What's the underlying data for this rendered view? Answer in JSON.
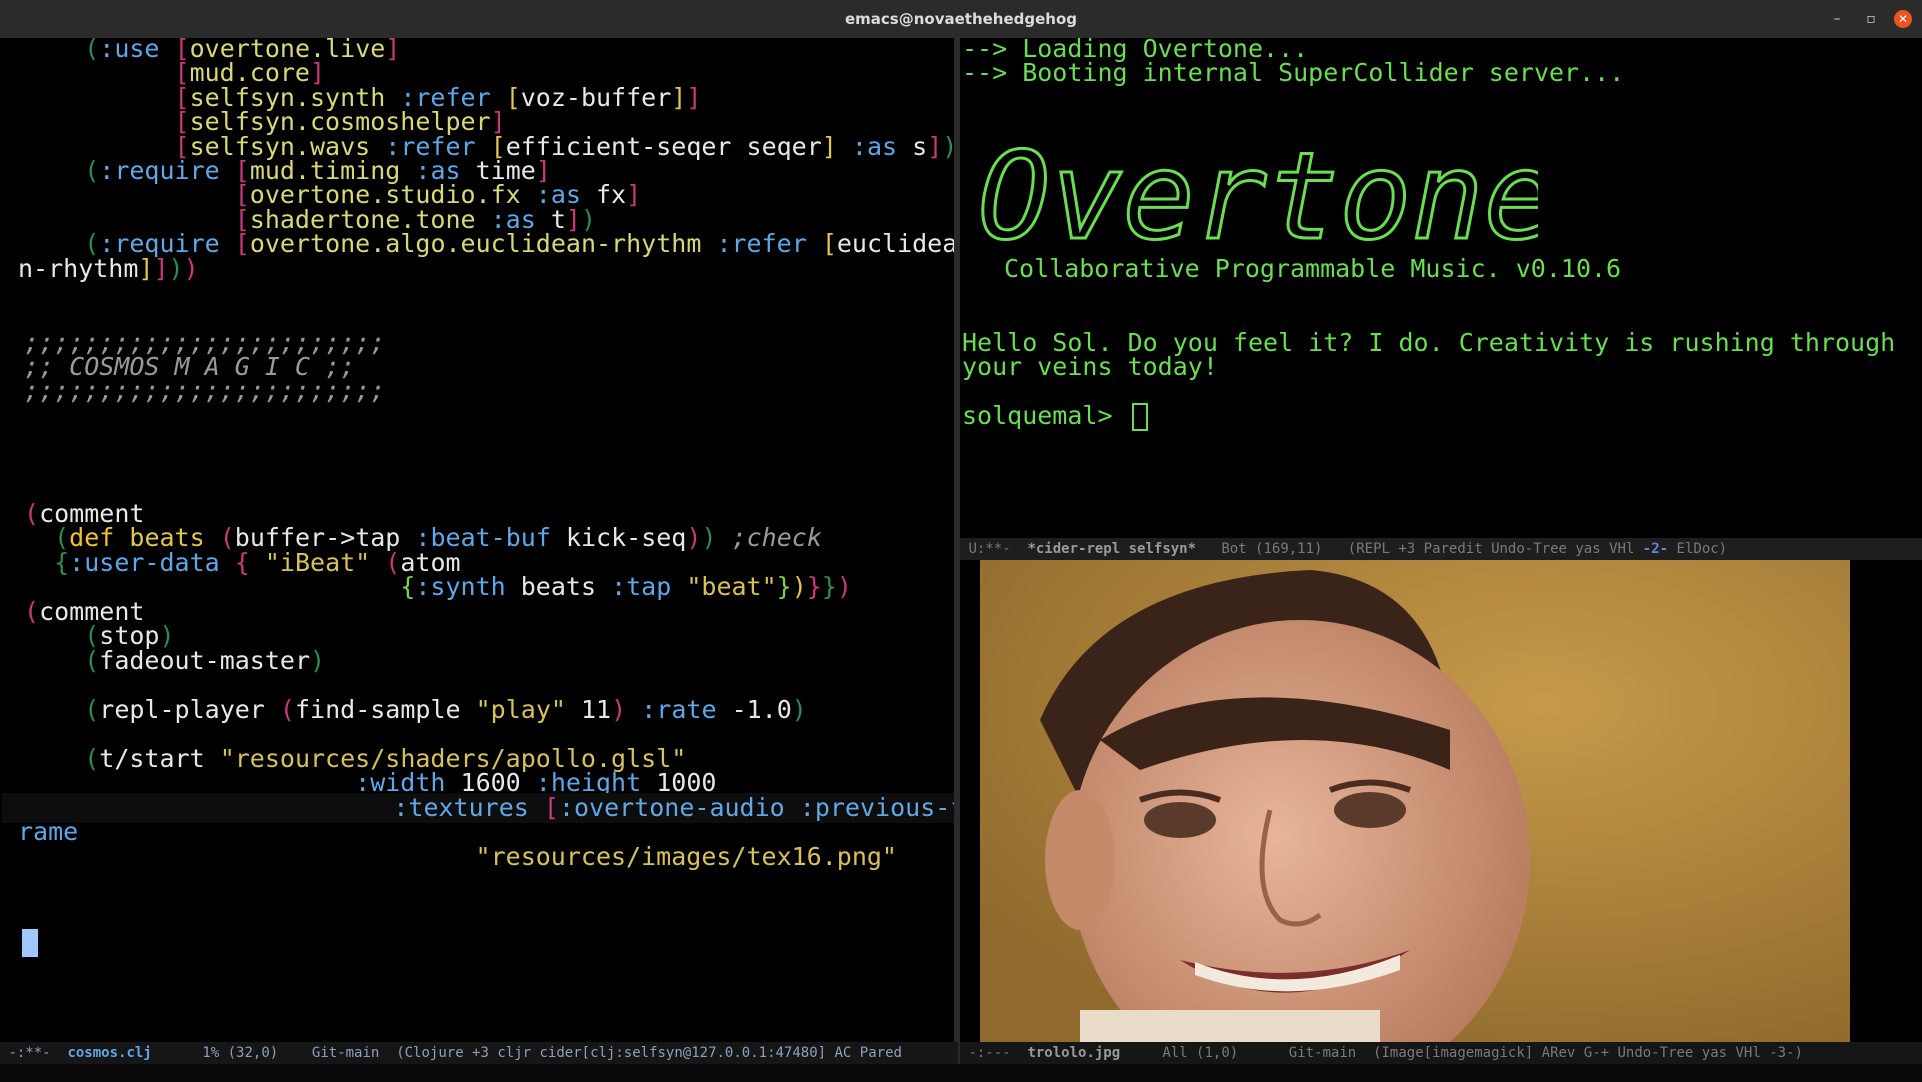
{
  "window": {
    "title": "emacs@novaethehedgehog"
  },
  "editor": {
    "lines": [
      "(:use [overtone.live]",
      "      [mud.core]",
      "      [selfsyn.synth :refer [voz-buffer]]",
      "      [selfsyn.cosmoshelper]",
      "      [selfsyn.wavs :refer [efficient-seqer seqer] :as s])",
      "(:require [mud.timing :as time]",
      "          [overtone.studio.fx :as fx]",
      "          [shadertone.tone :as t])",
      "(:require [overtone.algo.euclidean-rhythm :refer [euclidea",
      "n-rhythm]]))",
      ";;;;;;;;;;;;;;;;;;;;;;;;",
      ";; COSMOS M A G I C ;;",
      ";;;;;;;;;;;;;;;;;;;;;;;;",
      "(comment",
      "(def beats (buffer->tap :beat-buf kick-seq)) ;check",
      "{:user-data { \"iBeat\" (atom",
      "{:synth beats :tap \"beat\"})}})",
      "(comment",
      "(stop)",
      "(fadeout-master)",
      "(repl-player (find-sample \"play\" 11) :rate -1.0)",
      "(t/start \"resources/shaders/apollo.glsl\"",
      ":width 1600 :height 1000",
      ":textures [:overtone-audio :previous-f",
      "rame",
      "\"resources/images/tex16.png\""
    ]
  },
  "repl": {
    "loading": "--> Loading Overtone...",
    "booting": "--> Booting internal SuperCollider server...",
    "logo": "Overtone",
    "tagline": "Collaborative Programmable Music. v0.10.6",
    "greeting_1": "Hello Sol. Do you feel it? I do. Creativity is rushing through",
    "greeting_2": "your veins today!",
    "prompt": "solquemal>"
  },
  "modelines": {
    "repl": {
      "state": "U:**-",
      "buffer": "*cider-repl selfsyn*",
      "position": "Bot (169,11)",
      "modes": "(REPL +3 Paredit Undo-Tree yas VHl",
      "window_num": "-2-",
      "tail": "ElDoc)"
    },
    "editor": {
      "state": "-:**-",
      "buffer": "cosmos.clj",
      "position": "1% (32,0)",
      "vc": "Git-main",
      "modes": "(Clojure +3 cljr cider[clj:selfsyn@127.0.0.1:47480] AC Pared"
    },
    "image": {
      "state": "-:---",
      "buffer": "trololo.jpg",
      "position": "All (1,0)",
      "vc": "Git-main",
      "modes": "(Image[imagemagick] ARev G-+ Undo-Tree yas VHl",
      "window_num": "-3-",
      "tail": ")"
    }
  },
  "colors": {
    "repl_text": "#6bdc53",
    "keyword": "#5fa7e6",
    "bracket": "#c8397a",
    "close_button": "#e95420"
  }
}
